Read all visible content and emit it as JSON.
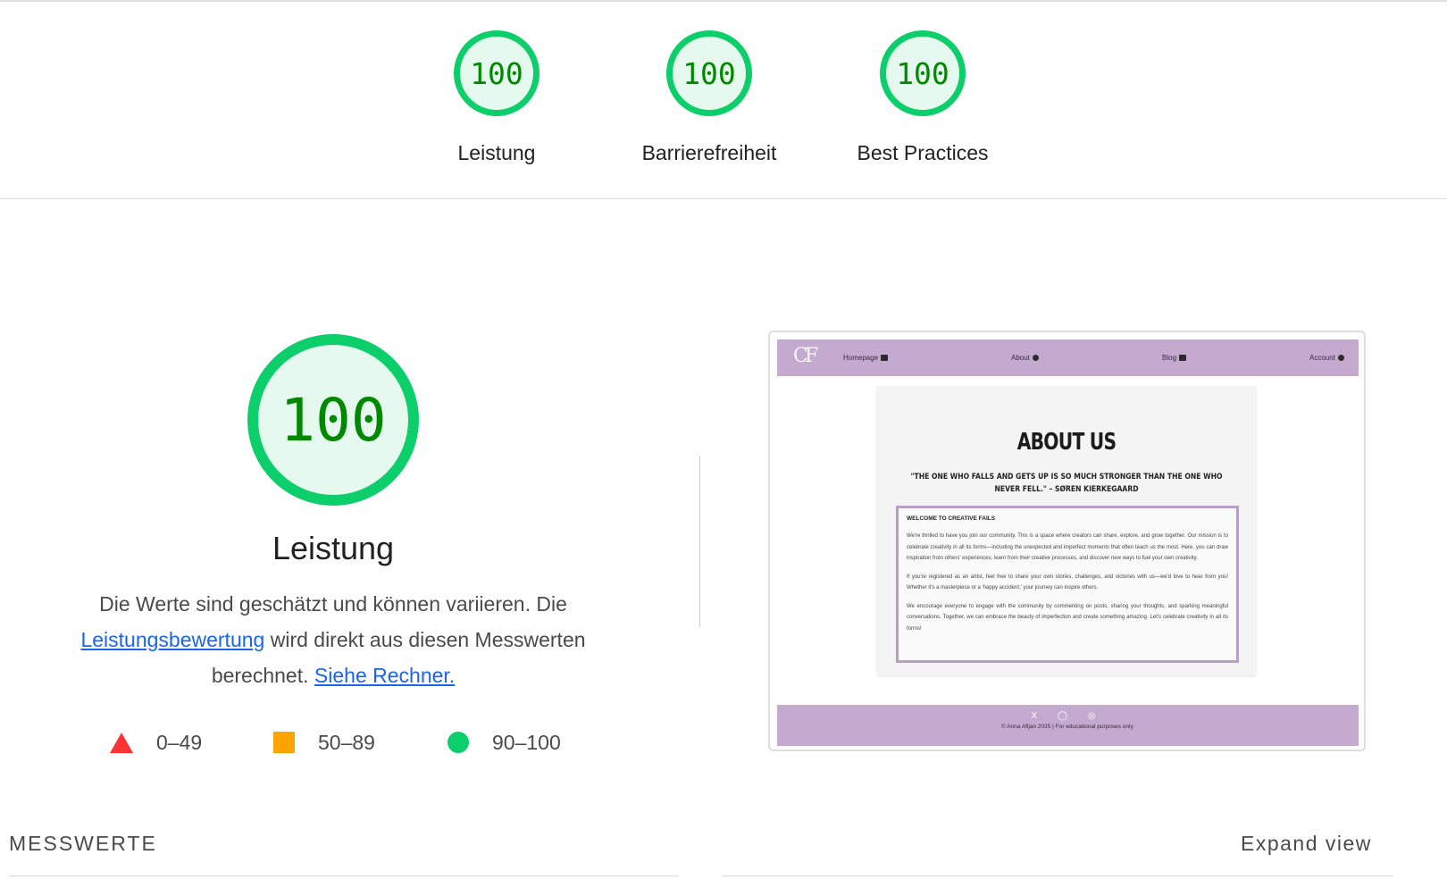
{
  "summary": {
    "gauges": [
      {
        "score": "100",
        "label": "Leistung"
      },
      {
        "score": "100",
        "label": "Barrierefreiheit"
      },
      {
        "score": "100",
        "label": "Best Practices"
      }
    ]
  },
  "performance": {
    "score": "100",
    "title": "Leistung",
    "description_part1": "Die Werte sind geschätzt und können variieren. Die",
    "description_link1": "Leistungsbewertung",
    "description_part2": "wird direkt aus diesen Messwerten berechnet.",
    "description_link2": "Siehe Rechner.",
    "legend": [
      {
        "range": "0–49",
        "color": "#ff3333",
        "shape": "triangle"
      },
      {
        "range": "50–89",
        "color": "#ffa400",
        "shape": "square"
      },
      {
        "range": "90–100",
        "color": "#0cce6b",
        "shape": "circle"
      }
    ]
  },
  "screenshot": {
    "logo": "CF",
    "nav": [
      "Homepage",
      "About",
      "Blog",
      "Account"
    ],
    "heading": "ABOUT US",
    "quote": "\"THE ONE WHO FALLS AND GETS UP IS SO MUCH STRONGER THAN THE ONE WHO NEVER FELL.\" – SØREN KIERKEGAARD",
    "box_title": "WELCOME TO CREATIVE FAILS",
    "paragraphs": [
      "We're thrilled to have you join our community. This is a space where creators can share, explore, and grow together. Our mission is to celebrate creativity in all its forms—including the unexpected and imperfect moments that often teach us the most. Here, you can draw inspiration from others' experiences, learn from their creative processes, and discover new ways to fuel your own creativity.",
      "If you're registered as an artist, feel free to share your own stories, challenges, and victories with us—we'd love to hear from you! Whether it's a masterpiece or a 'happy accident,' your journey can inspire others.",
      "We encourage everyone to engage with the community by commenting on posts, sharing your thoughts, and sparking meaningful conversations. Together, we can embrace the beauty of imperfection and create something amazing. Let's celebrate creativity in all its forms!"
    ],
    "footer_icons": "X ◯ ◎",
    "footer_copy": "© Anna Afljan 2025 | For educational purposes only."
  },
  "metrics": {
    "section_label": "MESSWERTE",
    "expand_label": "Expand view"
  },
  "colors": {
    "pass_green": "#0cce6b",
    "score_text": "#008800",
    "link_blue": "#1a66e8",
    "site_purple": "#c5aacf"
  }
}
